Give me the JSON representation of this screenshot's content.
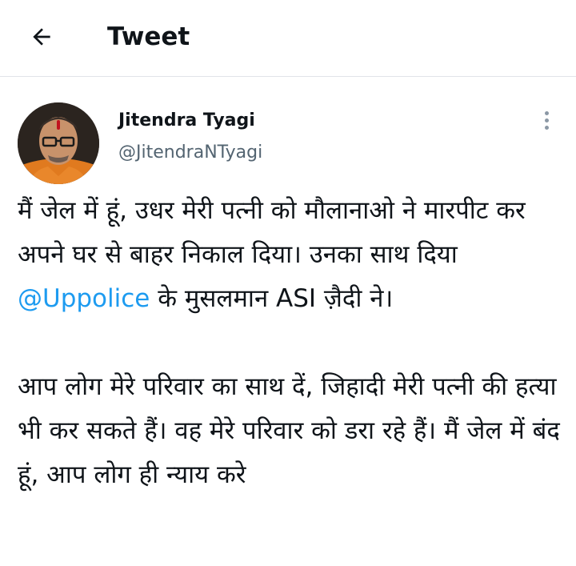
{
  "header": {
    "title": "Tweet"
  },
  "author": {
    "name": "Jitendra Tyagi",
    "handle": "@JitendraNTyagi"
  },
  "tweet": {
    "para1_part1": "मैं जेल में हूं, उधर मेरी पत्नी को मौलानाओ ने मारपीट कर अपने घर से बाहर निकाल दिया। उनका साथ दिया ",
    "mention": "@Uppolice",
    "para1_part2": " के मुसलमान ASI ज़ैदी ने।",
    "para2": "आप लोग मेरे परिवार का साथ दें, जिहादी मेरी पत्नी की हत्या भी कर सकते हैं। वह मेरे परिवार को डरा रहे हैं। मैं जेल में बंद हूं, आप लोग ही न्याय करे"
  },
  "colors": {
    "text": "#0f1419",
    "secondary": "#536471",
    "link": "#1d9bf0",
    "divider": "#e1e4e8"
  },
  "icons": {
    "back": "arrow-left-icon",
    "more": "more-vertical-icon"
  }
}
